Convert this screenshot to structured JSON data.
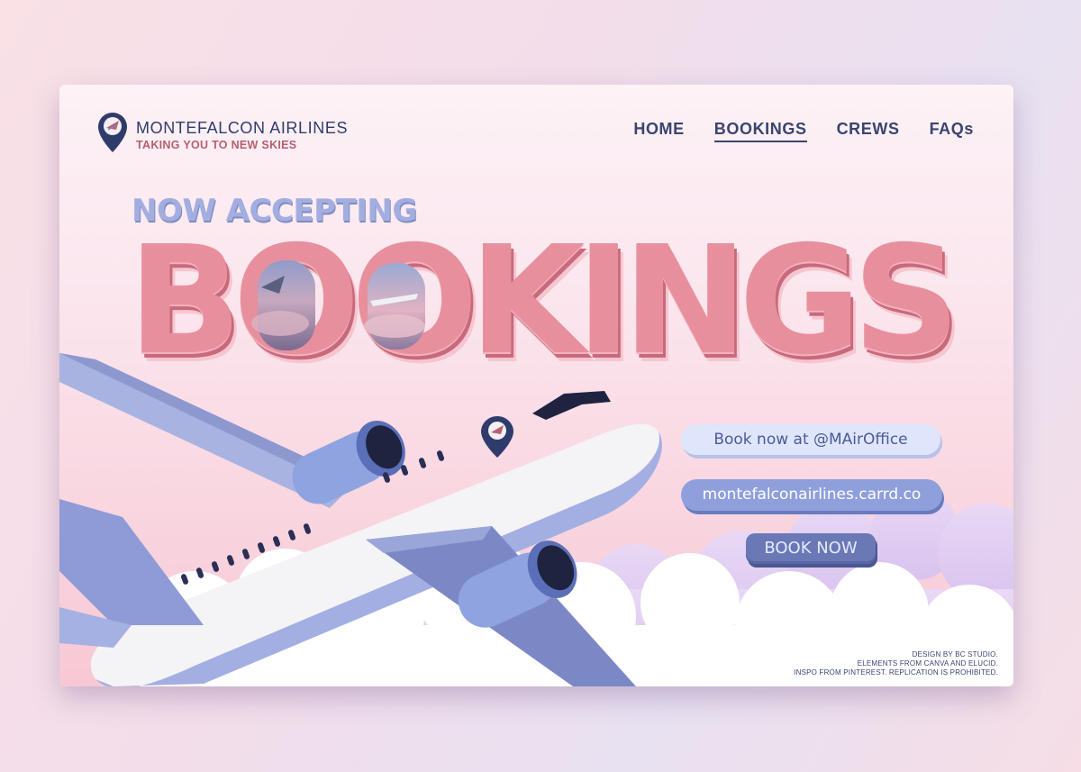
{
  "brand": {
    "name": "MONTEFALCON AIRLINES",
    "tagline": "TAKING YOU TO NEW SKIES",
    "logo_icon": "map-pin-plane-icon"
  },
  "nav": {
    "items": [
      {
        "label": "HOME",
        "active": false
      },
      {
        "label": "BOOKINGS",
        "active": true
      },
      {
        "label": "CREWS",
        "active": false
      },
      {
        "label": "FAQs",
        "active": false
      }
    ]
  },
  "hero": {
    "eyebrow": "NOW ACCEPTING",
    "headline": "BOOKINGS"
  },
  "cta": {
    "book_at": "Book now at @MAirOffice",
    "website": "montefalconairlines.carrd.co",
    "book_now": "BOOK NOW"
  },
  "credits": {
    "line1": "DESIGN BY BC STUDIO.",
    "line2": "ELEMENTS FROM CANVA AND ELUCID.",
    "line3": "INSPO  FROM PINTEREST. REPLICATION IS PROHIBITED."
  },
  "colors": {
    "accent_pink": "#e88f9d",
    "navy": "#2f3c6b",
    "periwinkle": "#8e9fdc"
  }
}
